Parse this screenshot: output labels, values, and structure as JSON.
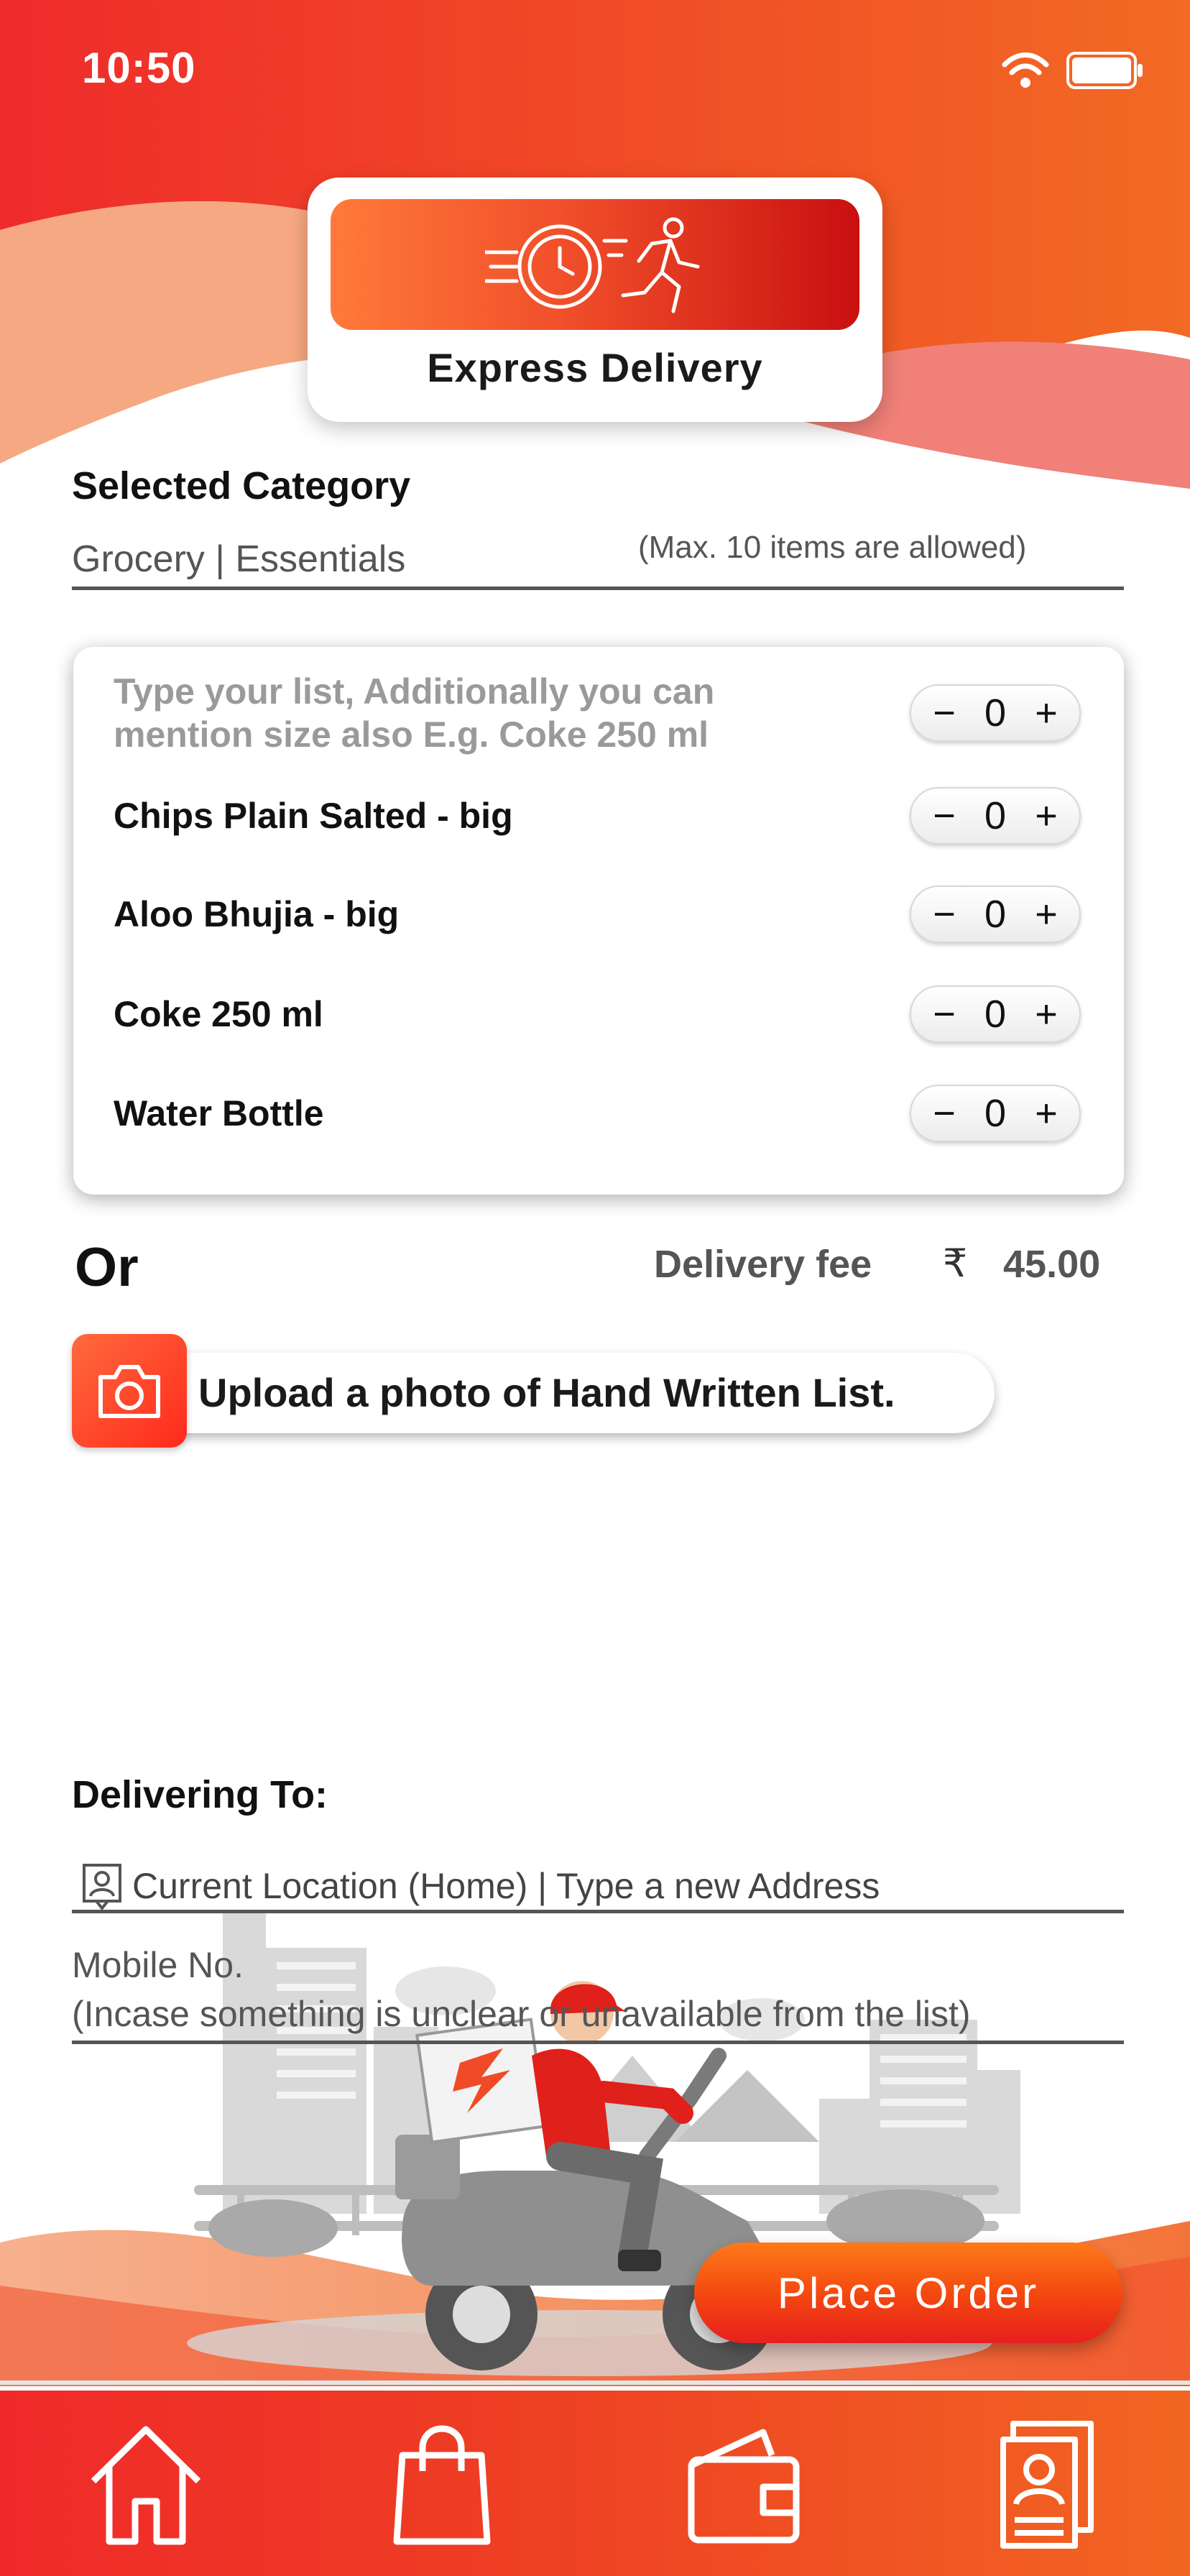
{
  "status_bar": {
    "time": "10:50"
  },
  "header": {
    "title": "Express Delivery"
  },
  "category": {
    "title": "Selected Category",
    "value": "Grocery | Essentials",
    "note": "(Max. 10 items are allowed)"
  },
  "items": [
    {
      "label": "Type your list, Additionally you can mention size also E.g. Coke 250 ml",
      "qty": "0"
    },
    {
      "label": "Chips Plain Salted - big",
      "qty": "0"
    },
    {
      "label": "Aloo Bhujia - big",
      "qty": "0"
    },
    {
      "label": "Coke 250 ml",
      "qty": "0"
    },
    {
      "label": "Water Bottle",
      "qty": "0"
    }
  ],
  "stepper": {
    "minus": "−",
    "plus": "+"
  },
  "or_label": "Or",
  "delivery_fee": {
    "label": "Delivery fee",
    "currency": "₹",
    "value": "45.00"
  },
  "upload": {
    "label": "Upload a photo of Hand Written List."
  },
  "delivering": {
    "title": "Delivering To:",
    "address_placeholder": "Current Location (Home) | Type a new Address",
    "mobile_line1": "Mobile No.",
    "mobile_line2": "(Incase something is unclear or unavailable from the list)"
  },
  "place_order": "Place Order",
  "nav": [
    {
      "icon": "home-icon"
    },
    {
      "icon": "shopping-bag-icon"
    },
    {
      "icon": "wallet-icon"
    },
    {
      "icon": "profile-document-icon"
    }
  ],
  "colors": {
    "accent_red": "#ee2a24",
    "accent_orange": "#f26522",
    "text_dark": "#111111",
    "text_muted": "#555555"
  }
}
